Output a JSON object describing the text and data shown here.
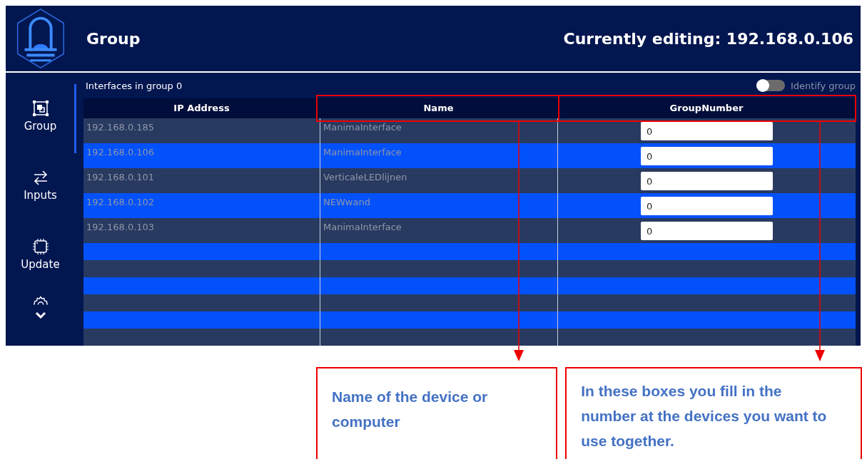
{
  "header": {
    "title": "Group",
    "editing": "Currently editing: 192.168.0.106"
  },
  "sidebar": {
    "items": [
      {
        "label": "Group",
        "kind": "group",
        "selected": true
      },
      {
        "label": "Inputs",
        "kind": "inputs",
        "selected": false
      },
      {
        "label": "Update",
        "kind": "update",
        "selected": false
      }
    ]
  },
  "group_label": "Interfaces in group 0",
  "identify": {
    "label": "Identify group",
    "on": false
  },
  "table": {
    "columns": [
      "IP Address",
      "Name",
      "GroupNumber"
    ],
    "rows": [
      {
        "ip": "192.168.0.185",
        "name": "ManimaInterface",
        "group": "0"
      },
      {
        "ip": "192.168.0.106",
        "name": "ManimaInterface",
        "group": "0"
      },
      {
        "ip": "192.168.0.101",
        "name": "VerticaleLEDlijnen",
        "group": "0"
      },
      {
        "ip": "192.168.0.102",
        "name": "NEWwand",
        "group": "0"
      },
      {
        "ip": "192.168.0.103",
        "name": "ManimaInterface",
        "group": "0"
      }
    ]
  },
  "callouts": [
    {
      "text": "Name of the device or computer"
    },
    {
      "text": "In these boxes you fill in the number at the devices you want to use together."
    }
  ]
}
